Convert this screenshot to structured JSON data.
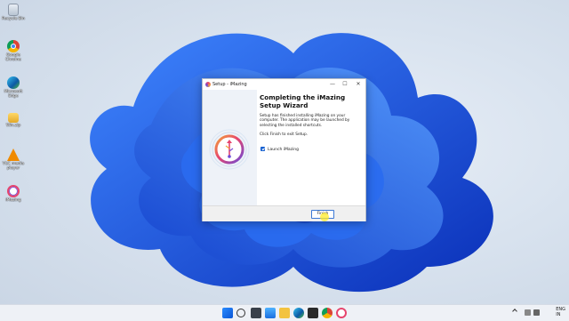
{
  "desktop": {
    "icons": [
      {
        "label": "Recycle Bin",
        "icon": "recycle-bin-icon"
      },
      {
        "label": "Google\nChrome",
        "icon": "chrome-icon"
      },
      {
        "label": "Microsoft\nEdge",
        "icon": "edge-icon"
      },
      {
        "label": "Win.zip",
        "icon": "folder-zip-icon"
      },
      {
        "label": "VLC media\nplayer",
        "icon": "vlc-icon"
      },
      {
        "label": "iMazing",
        "icon": "imazing-icon"
      }
    ]
  },
  "dialog": {
    "title": "Setup - iMazing",
    "heading": "Completing the iMazing Setup Wizard",
    "paragraph1": "Setup has finished installing iMazing on your computer. The application may be launched by selecting the installed shortcuts.",
    "paragraph2": "Click Finish to exit Setup.",
    "checkbox_label": "Launch iMazing",
    "checkbox_checked": true,
    "finish_label": "Finish",
    "minimize": "—",
    "maximize": "☐",
    "close": "✕"
  },
  "taskbar": {
    "lang_top": "ENG",
    "lang_bottom": "IN"
  },
  "colors": {
    "accent": "#1560d0",
    "bloom": "#1f5fe0"
  }
}
